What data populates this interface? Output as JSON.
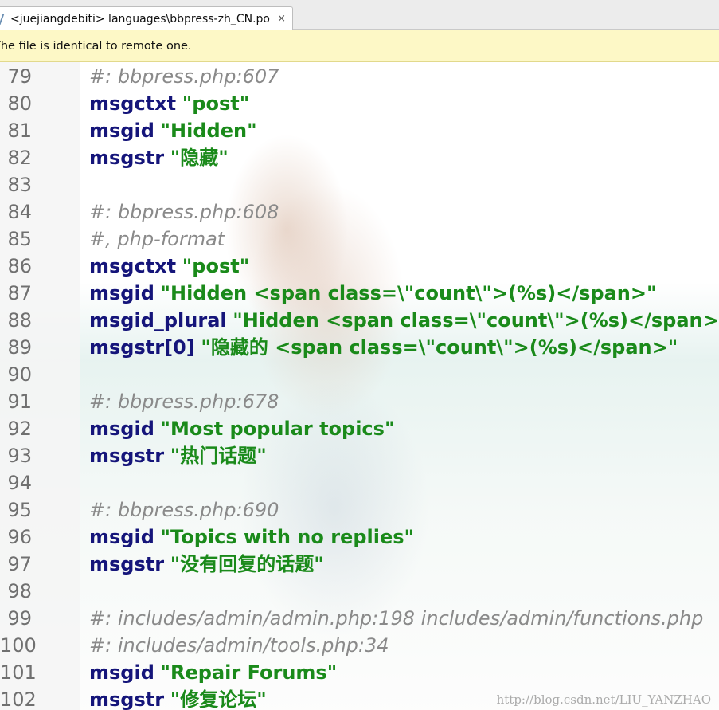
{
  "tab": {
    "title": "<juejiangdebiti> languages\\bbpress-zh_CN.po",
    "close_label": "×"
  },
  "notice": {
    "text": "The file is identical to remote one."
  },
  "editor": {
    "lines": [
      {
        "num": "79",
        "kind": "comment",
        "comment": "#: bbpress.php:607"
      },
      {
        "num": "80",
        "kind": "entry",
        "key": "msgctxt",
        "value": "\"post\""
      },
      {
        "num": "81",
        "kind": "entry",
        "key": "msgid",
        "value": "\"Hidden\""
      },
      {
        "num": "82",
        "kind": "entry",
        "key": "msgstr",
        "value": "\"隐藏\""
      },
      {
        "num": "83",
        "kind": "blank"
      },
      {
        "num": "84",
        "kind": "comment",
        "comment": "#: bbpress.php:608"
      },
      {
        "num": "85",
        "kind": "comment",
        "comment": "#, php-format"
      },
      {
        "num": "86",
        "kind": "entry",
        "key": "msgctxt",
        "value": "\"post\""
      },
      {
        "num": "87",
        "kind": "entry",
        "key": "msgid",
        "value": "\"Hidden <span class=\\\"count\\\">(%s)</span>\""
      },
      {
        "num": "88",
        "kind": "entry",
        "key": "msgid_plural",
        "value": "\"Hidden <span class=\\\"count\\\">(%s)</span>\""
      },
      {
        "num": "89",
        "kind": "entry",
        "key": "msgstr[0]",
        "value": "\"隐藏的 <span class=\\\"count\\\">(%s)</span>\""
      },
      {
        "num": "90",
        "kind": "blank"
      },
      {
        "num": "91",
        "kind": "comment",
        "comment": "#: bbpress.php:678"
      },
      {
        "num": "92",
        "kind": "entry",
        "key": "msgid",
        "value": "\"Most popular topics\""
      },
      {
        "num": "93",
        "kind": "entry",
        "key": "msgstr",
        "value": "\"热门话题\""
      },
      {
        "num": "94",
        "kind": "blank"
      },
      {
        "num": "95",
        "kind": "comment",
        "comment": "#: bbpress.php:690"
      },
      {
        "num": "96",
        "kind": "entry",
        "key": "msgid",
        "value": "\"Topics with no replies\""
      },
      {
        "num": "97",
        "kind": "entry",
        "key": "msgstr",
        "value": "\"没有回复的话题\""
      },
      {
        "num": "98",
        "kind": "blank"
      },
      {
        "num": "99",
        "kind": "comment",
        "comment": "#: includes/admin/admin.php:198 includes/admin/functions.php"
      },
      {
        "num": "100",
        "kind": "comment",
        "comment": "#: includes/admin/tools.php:34"
      },
      {
        "num": "101",
        "kind": "entry",
        "key": "msgid",
        "value": "\"Repair Forums\""
      },
      {
        "num": "102",
        "kind": "entry",
        "key": "msgstr",
        "value": "\"修复论坛\""
      }
    ]
  },
  "watermark": {
    "text": "http://blog.csdn.net/LIU_YANZHAO"
  },
  "colors": {
    "keyword": "#15157a",
    "string": "#1a8a1a",
    "comment": "#8a8a8a",
    "notice_bg": "#fdf8c6"
  }
}
